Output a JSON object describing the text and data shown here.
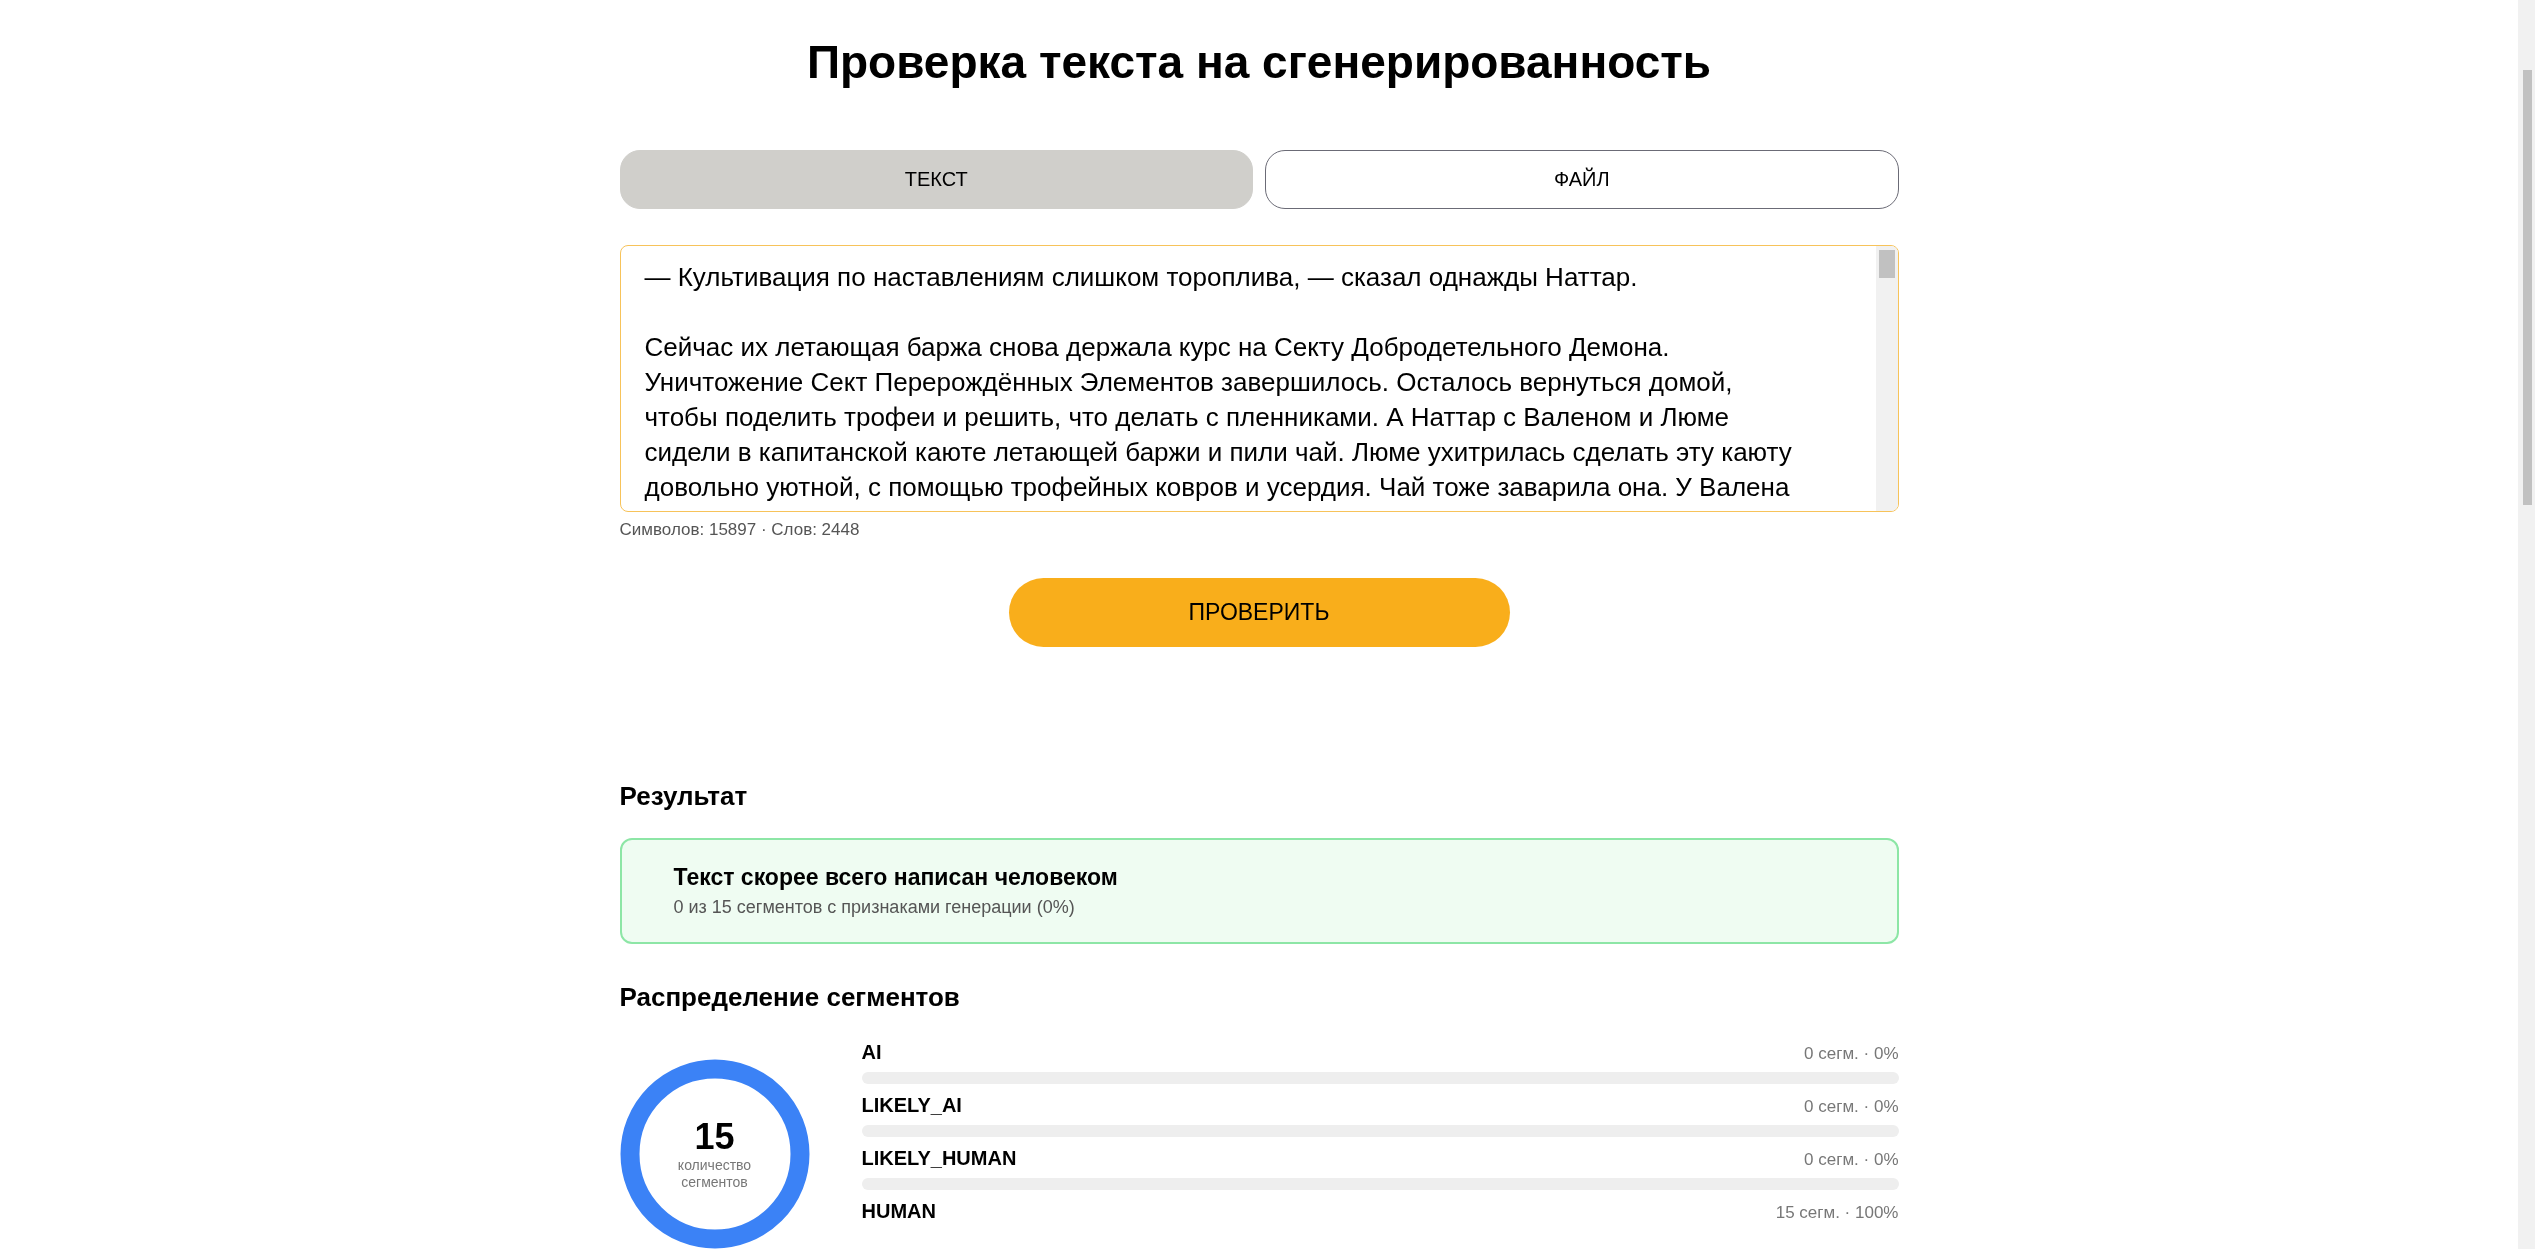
{
  "title": "Проверка текста на сгенерированность",
  "tabs": [
    {
      "label": "ТЕКСТ",
      "selected": true
    },
    {
      "label": "ФАЙЛ",
      "selected": false
    }
  ],
  "input": {
    "paragraphs": [
      "— Культивация по наставлениям слишком тороплива, — сказал однажды Наттар.",
      "Сейчас их летающая баржа снова держала курс на Секту Добродетельного Демона. Уничтожение Сект Перерождённых Элементов завершилось. Осталось вернуться домой, чтобы поделить трофеи и решить, что делать с пленниками. А Наттар с Валеном и Люме сидели в капитанской каюте летающей баржи и пили чай. Люме ухитрилась сделать эту каюту довольно уютной, с помощью трофейных ковров и усердия. Чай тоже заварила она. У Валена"
    ]
  },
  "counter": "Символов: 15897 · Слов: 2448",
  "check_button": "ПРОВЕРИТЬ",
  "result": {
    "heading": "Результат",
    "verdict": "Текст скорее всего написан человеком",
    "summary": "0 из 15 сегментов с признаками генерации (0%)"
  },
  "distribution": {
    "heading": "Распределение сегментов",
    "total": "15",
    "total_label": "количество сегментов",
    "rows": [
      {
        "label": "AI",
        "reading": "0 сегм. · 0%"
      },
      {
        "label": "LIKELY_AI",
        "reading": "0 сегм. · 0%"
      },
      {
        "label": "LIKELY_HUMAN",
        "reading": "0 сегм. · 0%"
      },
      {
        "label": "HUMAN",
        "reading": "15 сегм. · 100%"
      }
    ]
  }
}
